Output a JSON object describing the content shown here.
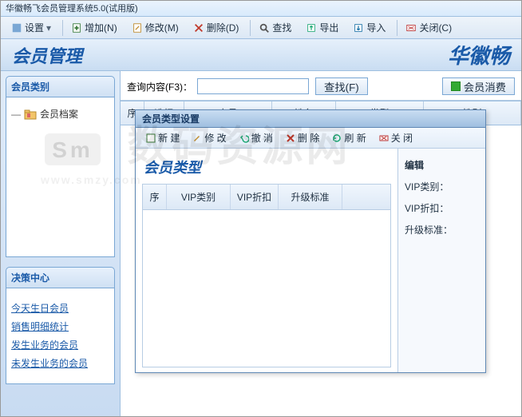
{
  "window": {
    "title": "华徽畅飞会员管理系统5.0(试用版)"
  },
  "toolbar": {
    "settings": "设置",
    "add": "增加(N)",
    "edit": "修改(M)",
    "delete": "删除(D)",
    "search": "查找",
    "export": "导出",
    "import": "导入",
    "close": "关闭(C)"
  },
  "banner": {
    "page_title": "会员管理",
    "brand": "华徽畅"
  },
  "sidebar": {
    "category_panel_title": "会员类别",
    "tree_item_member_archive": "会员档案",
    "decision_panel_title": "决策中心",
    "links": {
      "today_birthday": "今天生日会员",
      "sales_detail": "销售明细统计",
      "business_members": "发生业务的会员",
      "no_business_members": "未发生业务的会员"
    }
  },
  "search": {
    "label": "查询内容(F3)：",
    "value": "",
    "find_btn": "查找(F)",
    "consume_btn": "会员消费"
  },
  "main_grid": {
    "cols": [
      "序",
      "选择",
      "卡号",
      "姓名",
      "类型",
      "性别"
    ]
  },
  "dialog": {
    "title": "会员类型设置",
    "toolbar": {
      "new": "新 建",
      "edit": "修 改",
      "undo": "撤 消",
      "delete": "删 除",
      "refresh": "刷 新",
      "close": "关 闭"
    },
    "heading": "会员类型",
    "grid_cols": [
      "序",
      "VIP类别",
      "VIP折扣",
      "升级标准"
    ],
    "edit_panel": {
      "section": "编辑",
      "vip_type_label": "VIP类别：",
      "vip_discount_label": "VIP折扣：",
      "upgrade_label": "升级标准："
    }
  },
  "watermark": {
    "text": "数码资源网",
    "url": "www.smzy.com"
  }
}
